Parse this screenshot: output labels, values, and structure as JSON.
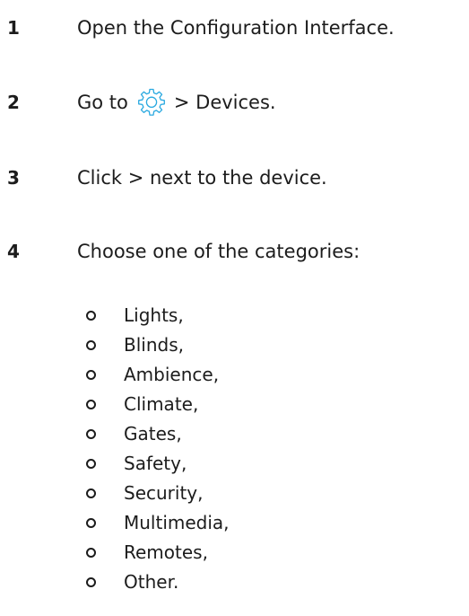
{
  "steps": [
    {
      "number": "1",
      "text": "Open the Configuration Interface."
    },
    {
      "number": "2",
      "text_before": "Go to",
      "icon": "gear-icon",
      "text_after": "> Devices."
    },
    {
      "number": "3",
      "text": "Click > next to the device."
    },
    {
      "number": "4",
      "text": "Choose one of the categories:"
    }
  ],
  "categories": [
    "Lights,",
    "Blinds,",
    "Ambience,",
    "Climate,",
    "Gates,",
    "Safety,",
    "Security,",
    "Multimedia,",
    "Remotes,",
    "Other."
  ],
  "colors": {
    "text": "#1c1c1c",
    "icon_accent": "#2aa9e0"
  }
}
